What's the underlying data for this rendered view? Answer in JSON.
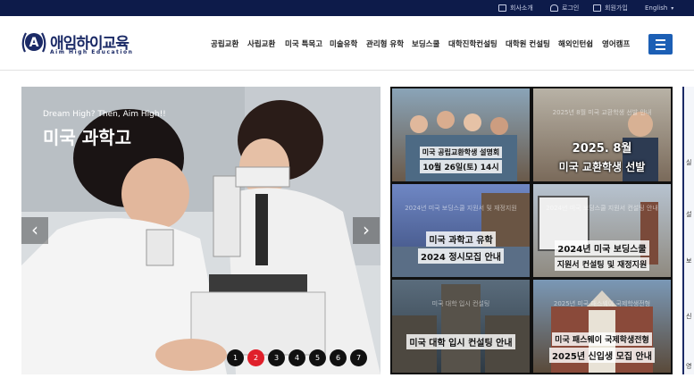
{
  "topbar": {
    "links": [
      {
        "label": "회사소개",
        "icon": "building-icon"
      },
      {
        "label": "로그인",
        "icon": "lock-icon"
      },
      {
        "label": "회원가입",
        "icon": "user-add-icon"
      },
      {
        "label": "English",
        "icon": "chevron-down-icon"
      }
    ]
  },
  "logo": {
    "name": "애임하이교육",
    "sub": "Aim High Education",
    "mark_letter": "A"
  },
  "nav": {
    "items": [
      "공립교환",
      "사립교환",
      "미국 특목고",
      "미술유학",
      "관리형 유학",
      "보딩스쿨",
      "대학진학컨설팅",
      "대학원 컨설팅",
      "해외인턴쉽",
      "영어캠프"
    ]
  },
  "slider": {
    "kicker": "Dream High? Then, Aim High!!",
    "title": "미국 과학고",
    "prev": "‹",
    "next": "›",
    "pages": [
      "1",
      "2",
      "3",
      "4",
      "5",
      "6",
      "7"
    ],
    "active_page": 2
  },
  "tiles": [
    {
      "faint": "",
      "lines": [
        "미국 공립교환학생 설명회",
        "10월 26일(토) 14시"
      ]
    },
    {
      "faint": "2025년 8월 미국 교환학생 선발 안내",
      "lines": [
        "2025. 8월",
        "미국 교환학생 선발"
      ]
    },
    {
      "faint": "2024년 미국 보딩스쿨 지원서 및 재정지원",
      "lines": [
        "미국 과학고 유학",
        "2024 정시모집 안내"
      ]
    },
    {
      "faint": "2024년 미국 보딩스쿨 지원서 컨설팅 안내",
      "lines": [
        "2024년 미국 보딩스쿨",
        "지원서 컨설팅 및 재정지원"
      ]
    },
    {
      "faint": "미국 대학 입시 컨설팅",
      "lines": [
        "미국 대학 입시 컨설팅 안내"
      ]
    },
    {
      "faint": "2025년 미국 패스웨이 국제학생전형",
      "lines": [
        "미국 패스웨이 국제학생전형",
        "2025년 신입생 모집 안내"
      ]
    }
  ],
  "side": {
    "tabs": [
      "실",
      "설",
      "보",
      "신",
      "영"
    ]
  },
  "colors": {
    "navy": "#0d1b4a",
    "brand": "#1b2a66",
    "menu": "#1c5fb5",
    "active_dot": "#e0202b"
  }
}
